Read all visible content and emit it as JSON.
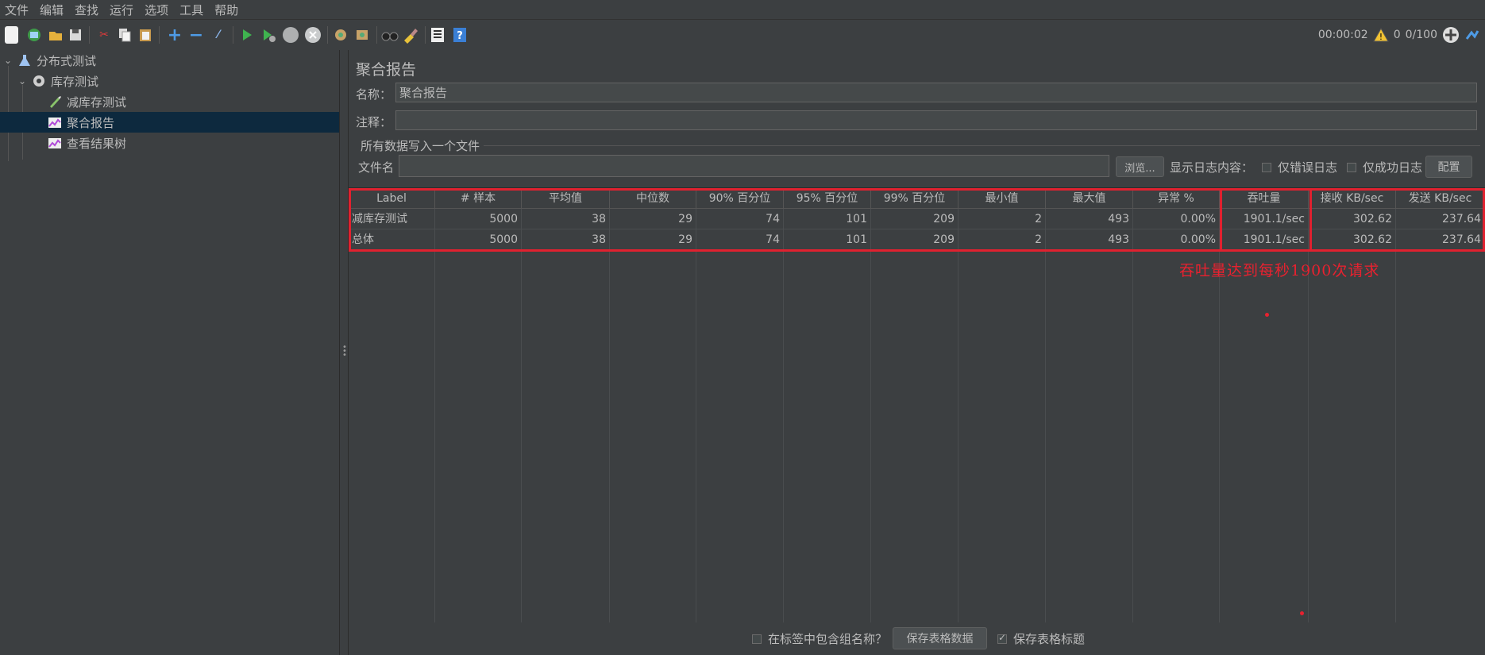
{
  "menu": [
    "文件",
    "编辑",
    "查找",
    "运行",
    "选项",
    "工具",
    "帮助"
  ],
  "toolbar_icons": [
    "new-icon",
    "templates-icon",
    "open-icon",
    "save-icon",
    "cut-icon",
    "copy-icon",
    "paste-icon",
    "expand-icon",
    "collapse-icon",
    "toggle-icon",
    "start-icon",
    "start-no-pause-icon",
    "stop-icon",
    "shutdown-icon",
    "clear-icon",
    "clear-all-icon",
    "search-icon",
    "reset-search-icon",
    "function-helper-icon",
    "help-icon"
  ],
  "status": {
    "elapsed": "00:00:02",
    "warnings": "0",
    "threads": "0/100"
  },
  "tree": [
    {
      "label": "分布式测试",
      "icon": "test-plan-icon",
      "level": 0,
      "expanded": true
    },
    {
      "label": "库存测试",
      "icon": "thread-group-icon",
      "level": 1,
      "expanded": true
    },
    {
      "label": "减库存测试",
      "icon": "sampler-icon",
      "level": 2
    },
    {
      "label": "聚合报告",
      "icon": "listener-icon",
      "level": 2,
      "selected": true
    },
    {
      "label": "查看结果树",
      "icon": "listener-icon",
      "level": 2
    }
  ],
  "panel": {
    "title": "聚合报告",
    "name_label": "名称：",
    "name_value": "聚合报告",
    "comment_label": "注释：",
    "comment_value": "",
    "file_group_title": "所有数据写入一个文件",
    "filename_label": "文件名",
    "filename_value": "",
    "browse_button": "浏览...",
    "log_label": "显示日志内容：",
    "errors_only": "仅错误日志",
    "success_only": "仅成功日志",
    "config_button": "配置"
  },
  "table": {
    "columns": [
      "Label",
      "# 样本",
      "平均值",
      "中位数",
      "90% 百分位",
      "95% 百分位",
      "99% 百分位",
      "最小值",
      "最大值",
      "异常 %",
      "吞吐量",
      "接收 KB/sec",
      "发送 KB/sec"
    ],
    "rows": [
      [
        "减库存测试",
        "5000",
        "38",
        "29",
        "74",
        "101",
        "209",
        "2",
        "493",
        "0.00%",
        "1901.1/sec",
        "302.62",
        "237.64"
      ],
      [
        "总体",
        "5000",
        "38",
        "29",
        "74",
        "101",
        "209",
        "2",
        "493",
        "0.00%",
        "1901.1/sec",
        "302.62",
        "237.64"
      ]
    ]
  },
  "annotation": "吞吐量达到每秒1900次请求",
  "annotation_color": "#e8212f",
  "bottom": {
    "include_group_name": "在标签中包含组名称？",
    "save_table_data": "保存表格数据",
    "save_table_header": "保存表格标题",
    "save_table_header_checked": true
  },
  "colors": {
    "background": "#3c3f41",
    "selection": "#0d293e",
    "text": "#bbbbbb"
  }
}
